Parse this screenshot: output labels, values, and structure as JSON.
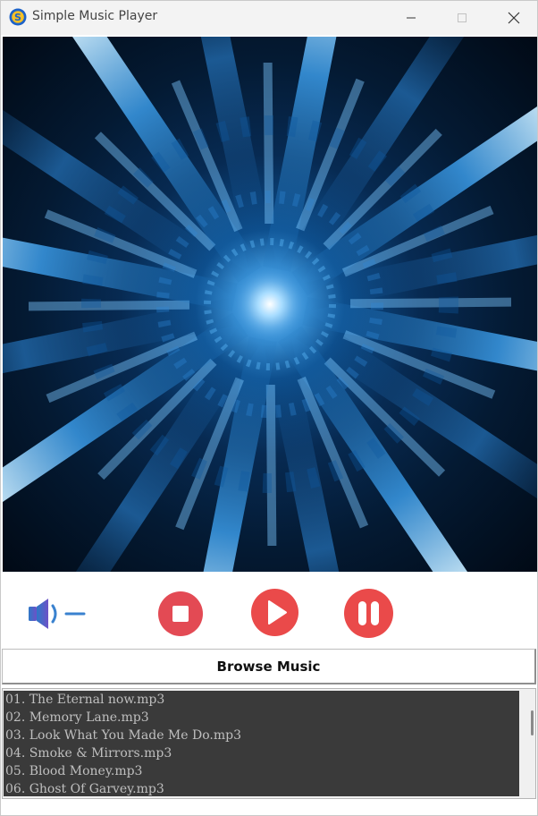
{
  "window": {
    "title": "Simple Music Player",
    "icon": "app-s-logo-icon",
    "controls": [
      "minimize-icon",
      "maximize-icon",
      "close-icon"
    ]
  },
  "album_art": {
    "description_icon": "kaleidoscope-artwork",
    "accent_color": "#2f8fe0"
  },
  "controls": {
    "volume_icon": "speaker-icon",
    "stop_icon": "stop-icon",
    "play_icon": "play-icon",
    "pause_icon": "pause-icon",
    "button_color": "#e9474c"
  },
  "browse": {
    "label": "Browse Music"
  },
  "playlist": {
    "items": [
      "01. The Eternal now.mp3",
      "02. Memory Lane.mp3",
      "03. Look What You Made Me Do.mp3",
      "04. Smoke & Mirrors.mp3",
      "05. Blood Money.mp3",
      "06. Ghost Of Garvey.mp3"
    ]
  }
}
